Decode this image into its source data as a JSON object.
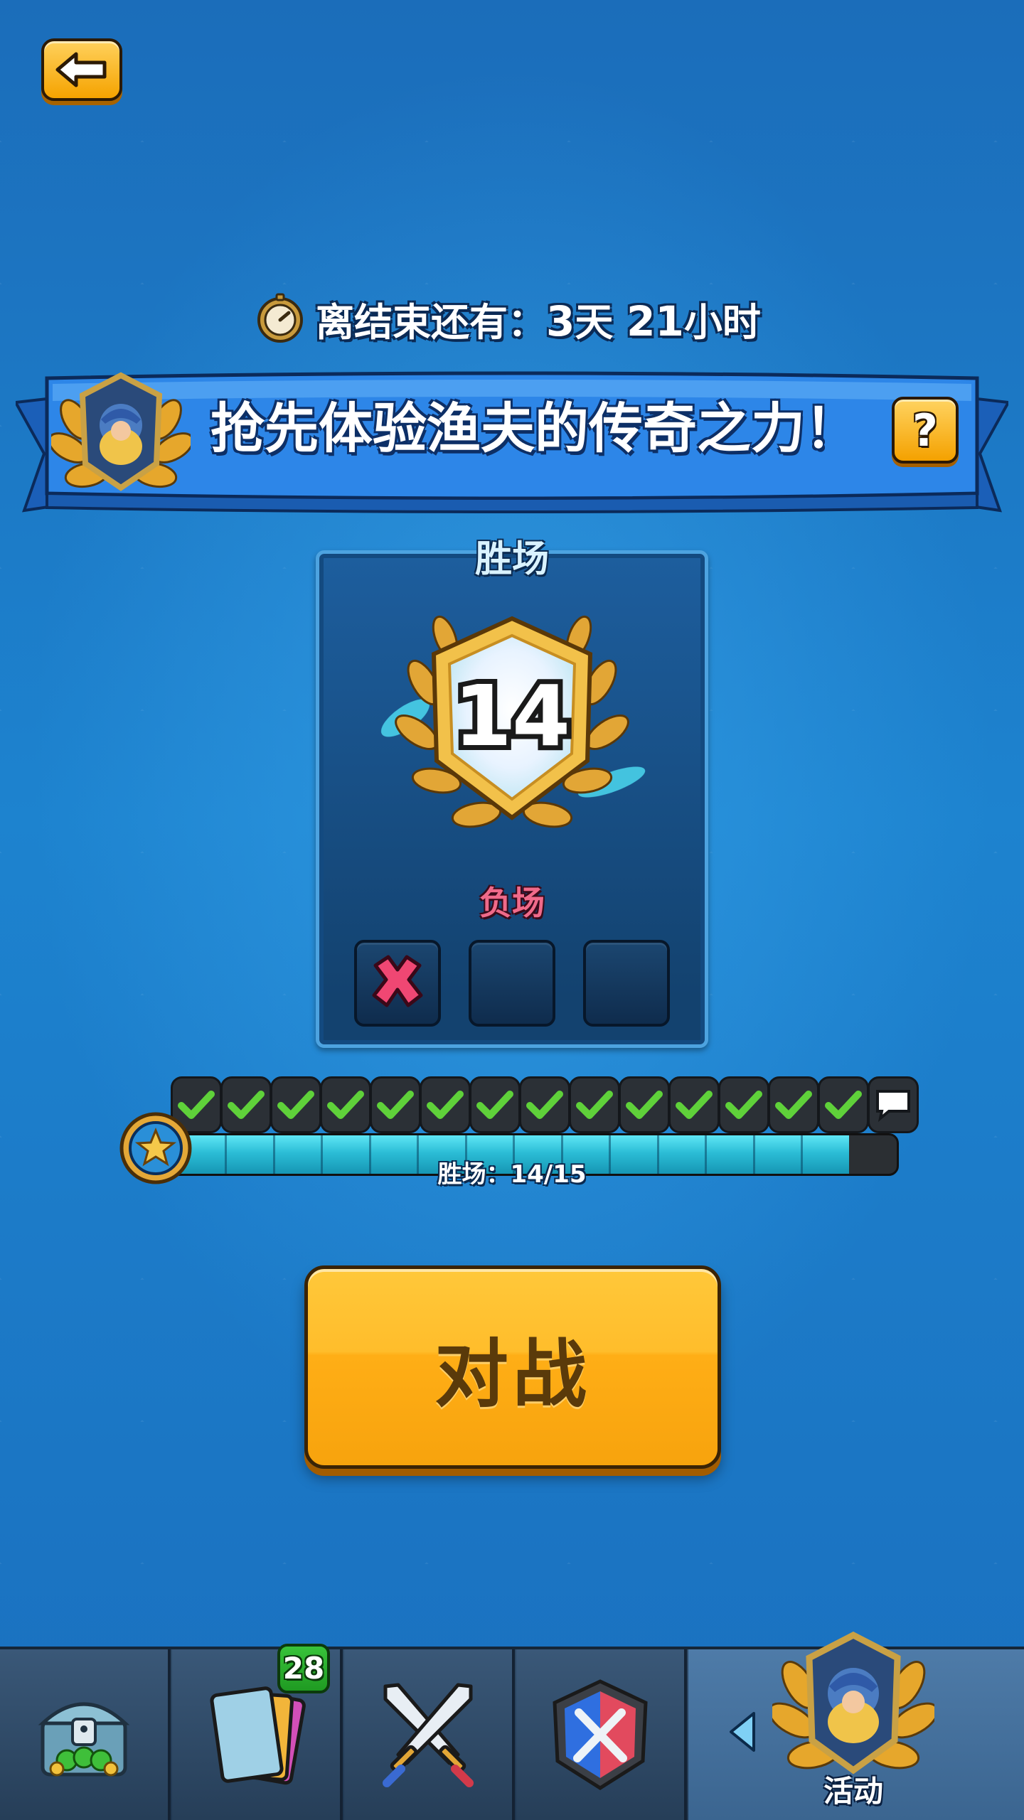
{
  "back_button": {
    "icon": "arrow-left-icon"
  },
  "timer": {
    "icon": "stopwatch-icon",
    "prefix": "离结束还有：",
    "days_value": "3",
    "days_unit": "天",
    "hours_value": "21",
    "hours_unit": "小时"
  },
  "banner": {
    "title": "抢先体验渔夫的传奇之力！",
    "emblem_icon": "fisherman-laurel-emblem-icon",
    "help_label": "?"
  },
  "panel": {
    "wins_label": "胜场",
    "wins_value": "14",
    "losses_label": "负场",
    "losses": [
      true,
      false,
      false
    ]
  },
  "progress": {
    "completed": 14,
    "total": 15,
    "label": "胜场：14/15",
    "final_reward_icon": "speech-bubble-icon"
  },
  "battle_button": {
    "label": "对战"
  },
  "nav": {
    "tabs": [
      {
        "name": "shop",
        "icon": "treasure-chest-icon"
      },
      {
        "name": "cards",
        "icon": "cards-icon",
        "badge": "28"
      },
      {
        "name": "battle",
        "icon": "crossed-swords-icon"
      },
      {
        "name": "clan",
        "icon": "clan-shield-icon"
      },
      {
        "name": "events",
        "icon": "fisherman-laurel-emblem-icon",
        "label": "活动"
      }
    ]
  },
  "colors": {
    "background": "#1c78c6",
    "banner": "#2a7fe0",
    "accent_gold": "#f5a300",
    "loss_red": "#f06a8a",
    "check_green": "#5fd13a",
    "progress_cyan": "#2bbdd6"
  }
}
